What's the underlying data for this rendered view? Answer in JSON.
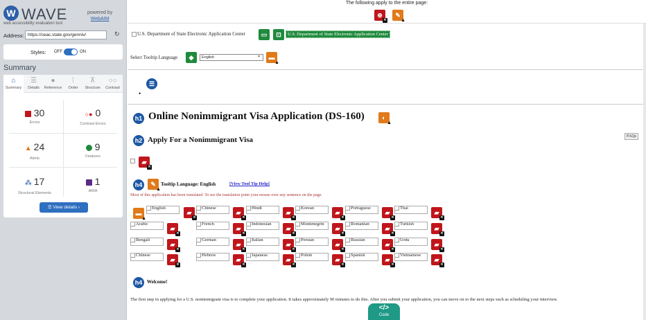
{
  "sidebar": {
    "logo_letter": "W",
    "app_name": "WAVE",
    "tagline": "web accessibility evaluation tool",
    "powered_by": "powered by",
    "webaim": "WebAIM",
    "address_label": "Address:",
    "address_value": "https://ceac.state.gov/genniv/",
    "styles_label": "Styles:",
    "styles_off": "OFF",
    "styles_on": "ON",
    "summary_title": "Summary",
    "tabs": [
      {
        "label": "Summary",
        "icon": "home-icon",
        "glyph": "⌂"
      },
      {
        "label": "Details",
        "icon": "list-icon",
        "glyph": "☰"
      },
      {
        "label": "Reference",
        "icon": "info-icon",
        "glyph": "●"
      },
      {
        "label": "Order",
        "icon": "order-icon",
        "glyph": "⁞"
      },
      {
        "label": "Structure",
        "icon": "structure-icon",
        "glyph": "⊼"
      },
      {
        "label": "Contrast",
        "icon": "contrast-icon",
        "glyph": "○○"
      }
    ],
    "stats": {
      "errors": {
        "value": "30",
        "label": "Errors",
        "color": "#c0161b"
      },
      "contrast": {
        "value": "0",
        "label": "Contrast Errors",
        "color": "#c0161b"
      },
      "alerts": {
        "value": "24",
        "label": "Alerts",
        "color": "#e07a1a"
      },
      "features": {
        "value": "9",
        "label": "Features",
        "color": "#1f8a3d"
      },
      "structural": {
        "value": "17",
        "label": "Structural Elements",
        "color": "#1d57a3"
      },
      "aria": {
        "value": "1",
        "label": "ARIA",
        "color": "#5b2a86"
      }
    },
    "view_details": "View details ›"
  },
  "main": {
    "top_notice": "The following apply to the entire page:",
    "dos_link_alt": "U.S. Department of State Electronic Application Center",
    "dos_link_highlight": "U.S. Department of State Electronic Application Center",
    "tooltip_language_label": "Select Tooltip Language",
    "tooltip_language_value": "English",
    "h1_badge": "h1",
    "h1_text": "Online Nonimmigrant Visa Application (DS-160)",
    "h2_badge": "h2",
    "h2_text": "Apply For a Nonimmigrant Visa",
    "faqs": "FAQs",
    "h4_badge": "h4",
    "tooltip_language_heading": "Tooltip Language: English",
    "view_help": "[View Tool Tip Help]",
    "translated_note": "Most of this application has been translated. To see the translation point your mouse over any sentence on the page.",
    "languages": [
      [
        "English",
        "Chinese",
        "Hindi",
        "Korean",
        "Portuguese",
        "Thai"
      ],
      [
        "Arabic",
        "French",
        "Indonesian",
        "Montenegrin",
        "Romanian",
        "Turkish"
      ],
      [
        "Bengali",
        "German",
        "Italian",
        "Persian",
        "Russian",
        "Urdu"
      ],
      [
        "Chinese",
        "Hebrew",
        "Japanese",
        "Polish",
        "Spanish",
        "Vietnamese"
      ]
    ],
    "welcome": "Welcome!",
    "intro_paragraph": "The first step in applying for a U.S. nonimmigrant visa is to complete your application. It takes approximately 90 minutes to do this. After you submit your application, you can move on to the next steps such as scheduling your interview.",
    "code_button": "Code",
    "code_glyph": "</>"
  }
}
